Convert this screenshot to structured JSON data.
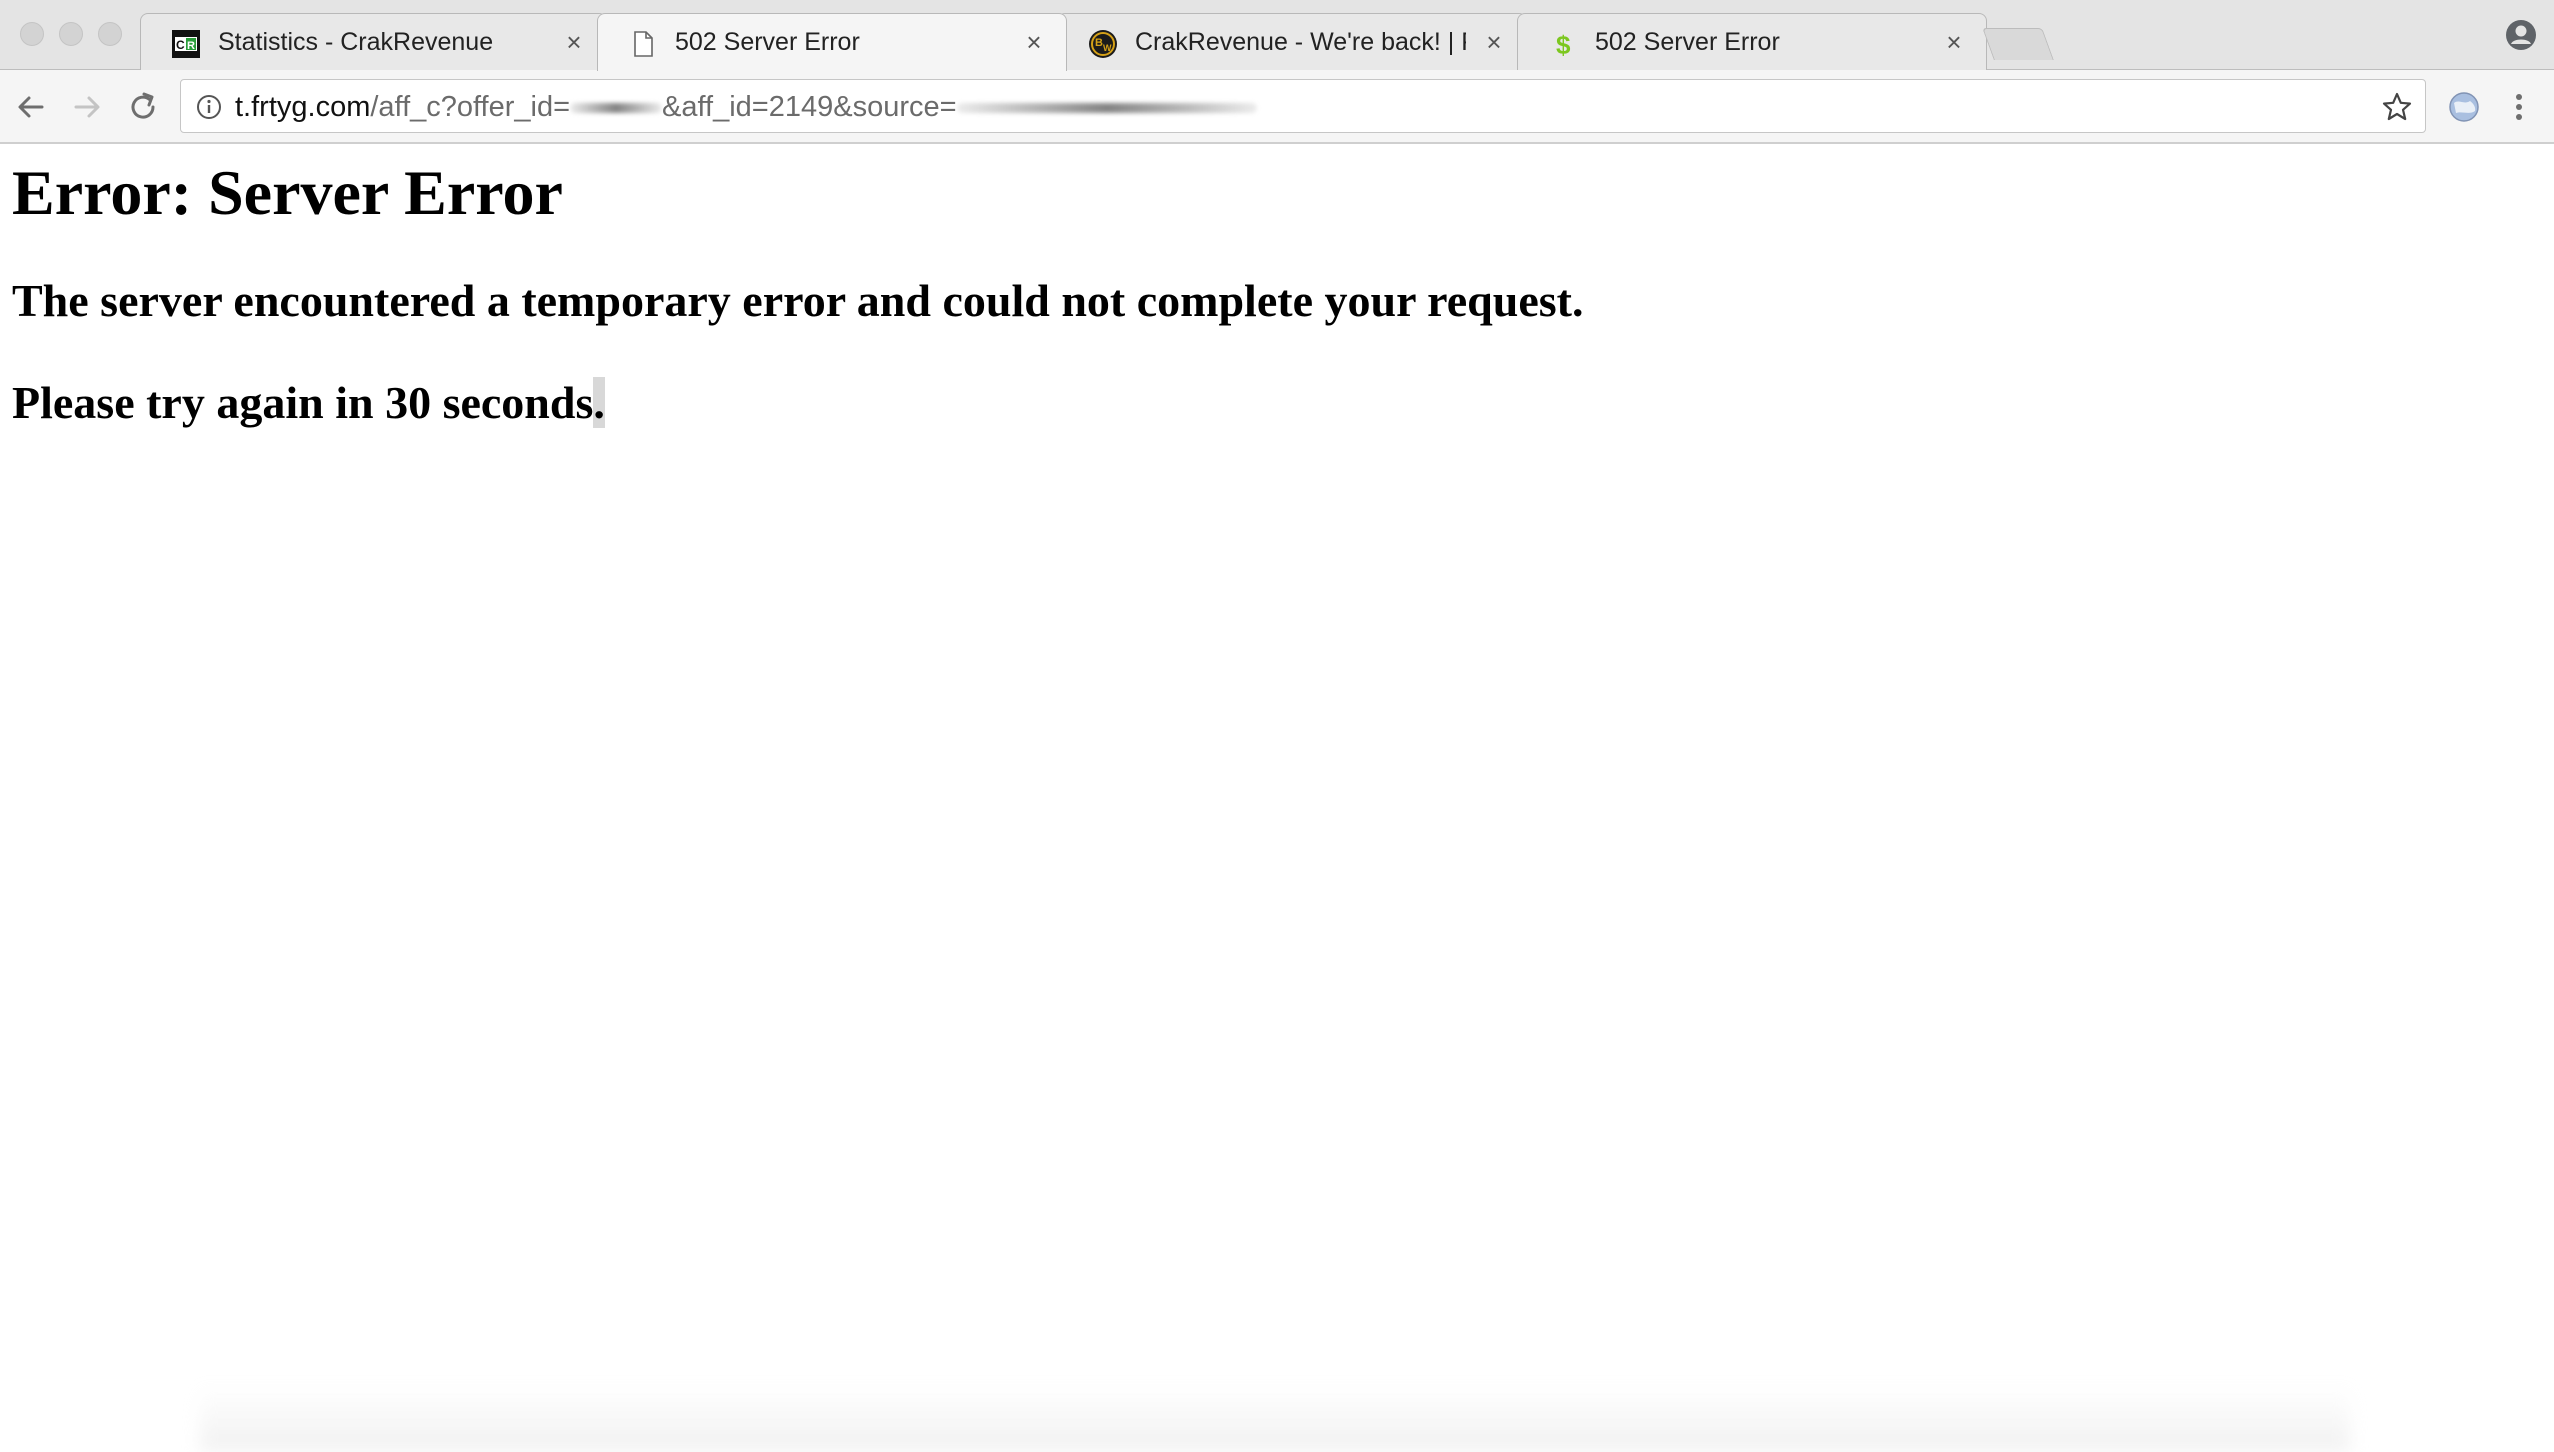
{
  "browser": {
    "tabs": [
      {
        "title": "Statistics - CrakRevenue",
        "favicon": "crakrevenue-logo-icon",
        "active": false
      },
      {
        "title": "502 Server Error",
        "favicon": "blank-page-icon",
        "active": true
      },
      {
        "title": "CrakRevenue - We're back! | P",
        "favicon": "bw-logo-icon",
        "active": false
      },
      {
        "title": "502 Server Error",
        "favicon": "dollar-sign-icon",
        "active": false
      }
    ],
    "close_glyph": "×",
    "address_bar": {
      "host": "t.frtyg.com",
      "path_part1": "/aff_c?offer_id=",
      "path_part2": "&aff_id=2149&source="
    }
  },
  "page": {
    "title": "Error: Server Error",
    "message": "The server encountered a temporary error and could not complete your request.",
    "retry_main": "Please try again in 30 seconds",
    "retry_end": "."
  },
  "colors": {
    "tabstrip_bg": "#e4e4e4",
    "toolbar_bg": "#f5f5f5",
    "crak_green": "#2a9d3a",
    "dollar_green": "#7cc71f",
    "text": "#000000"
  }
}
